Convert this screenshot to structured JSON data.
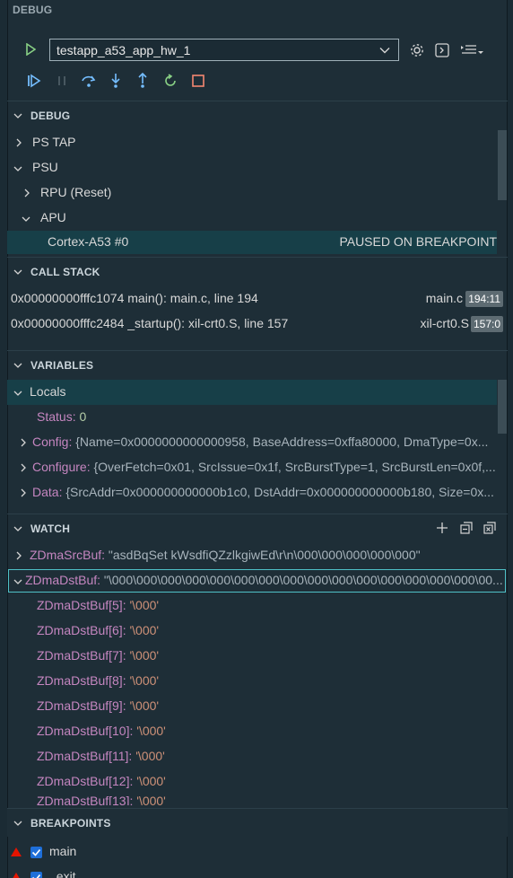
{
  "header": {
    "title": "DEBUG"
  },
  "config": {
    "selected": "testapp_a53_app_hw_1"
  },
  "sections": {
    "debug": "DEBUG",
    "callstack": "CALL STACK",
    "variables": "VARIABLES",
    "watch": "WATCH",
    "breakpoints": "BREAKPOINTS"
  },
  "debug_tree": [
    {
      "label": "PS TAP"
    },
    {
      "label": "PSU"
    },
    {
      "label": "RPU (Reset)"
    },
    {
      "label": "APU"
    },
    {
      "label": "Cortex-A53 #0",
      "status": "PAUSED ON BREAKPOINT"
    }
  ],
  "callstack": [
    {
      "frame": "0x00000000fffc1074 main(): main.c, line 194",
      "file": "main.c",
      "pos": "194:11"
    },
    {
      "frame": "0x00000000fffc2484 _startup(): xil-crt0.S, line 157",
      "file": "xil-crt0.S",
      "pos": "157:0"
    }
  ],
  "variables": {
    "scope": "Locals",
    "items": [
      {
        "name": "Status:",
        "value": "0"
      },
      {
        "name": "Config:",
        "value": "{Name=0x0000000000000958, BaseAddress=0xffa80000, DmaType=0x..."
      },
      {
        "name": "Configure:",
        "value": "{OverFetch=0x01, SrcIssue=0x1f, SrcBurstType=1, SrcBurstLen=0x0f,..."
      },
      {
        "name": "Data:",
        "value": "{SrcAddr=0x000000000000b1c0, DstAddr=0x000000000000b180, Size=0x..."
      }
    ]
  },
  "watch": {
    "items": [
      {
        "name": "ZDmaSrcBuf:",
        "value": "\"asdBqSet kWsdfiQZzlkgiwEd\\r\\n\\000\\000\\000\\000\\000\""
      },
      {
        "name": "ZDmaDstBuf:",
        "value": "\"\\000\\000\\000\\000\\000\\000\\000\\000\\000\\000\\000\\000\\000\\000\\000\\00..."
      }
    ],
    "children": [
      {
        "name": "ZDmaDstBuf[5]:",
        "value": "'\\000'"
      },
      {
        "name": "ZDmaDstBuf[6]:",
        "value": "'\\000'"
      },
      {
        "name": "ZDmaDstBuf[7]:",
        "value": "'\\000'"
      },
      {
        "name": "ZDmaDstBuf[8]:",
        "value": "'\\000'"
      },
      {
        "name": "ZDmaDstBuf[9]:",
        "value": "'\\000'"
      },
      {
        "name": "ZDmaDstBuf[10]:",
        "value": "'\\000'"
      },
      {
        "name": "ZDmaDstBuf[11]:",
        "value": "'\\000'"
      },
      {
        "name": "ZDmaDstBuf[12]:",
        "value": "'\\000'"
      },
      {
        "name": "ZDmaDstBuf[13]:",
        "value": "'\\000'"
      }
    ]
  },
  "breakpoints": [
    {
      "label": "main"
    },
    {
      "label": "_exit"
    }
  ],
  "colors": {
    "accent": "#4fc1c7",
    "play": "#89d185",
    "stop": "#f48771",
    "step": "#75beff"
  }
}
